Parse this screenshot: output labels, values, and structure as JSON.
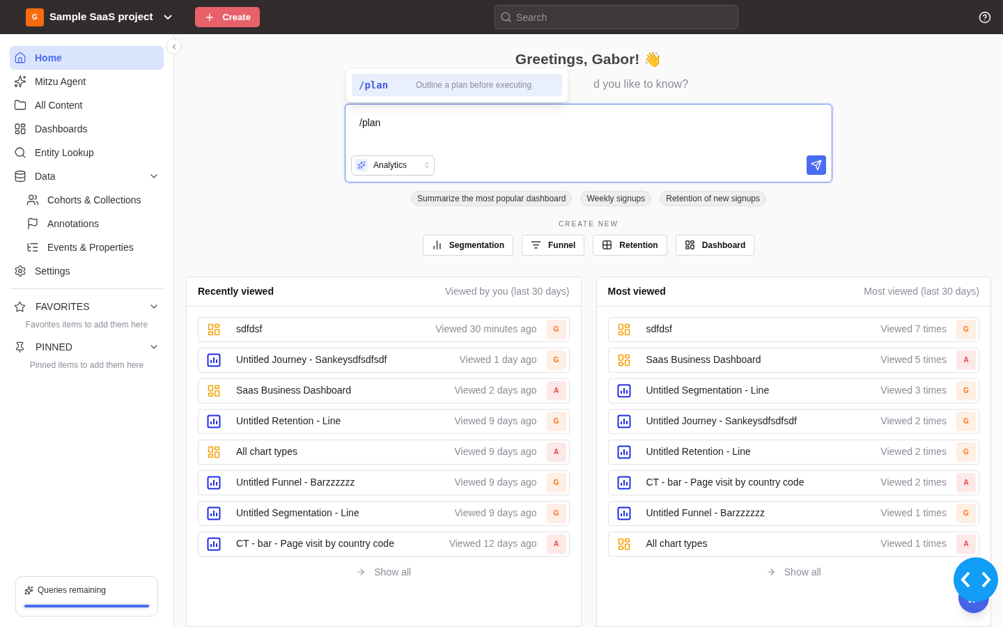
{
  "topbar": {
    "project_initial": "G",
    "project_name": "Sample SaaS project",
    "create_button": "Create",
    "search": {
      "placeholder": "Search"
    }
  },
  "sidebar": {
    "items": [
      {
        "label": "Home",
        "selected": true
      },
      {
        "label": "Mitzu Agent",
        "selected": false
      },
      {
        "label": "All Content",
        "selected": false
      },
      {
        "label": "Dashboards",
        "selected": false
      },
      {
        "label": "Entity Lookup",
        "selected": false
      },
      {
        "label": "Data",
        "selected": false,
        "expanded": true,
        "children": [
          {
            "label": "Cohorts & Collections",
            "selected": false
          },
          {
            "label": "Annotations",
            "selected": false
          },
          {
            "label": "Events & Properties",
            "selected": false
          }
        ]
      },
      {
        "label": "Settings",
        "selected": false
      }
    ],
    "sections": [
      {
        "label": "FAVORITES",
        "hint": "Favorites items to add them here"
      },
      {
        "label": "PINNED",
        "hint": "Pinned items to add them here"
      }
    ],
    "queries": {
      "label": "Queries remaining",
      "level": 1.0
    }
  },
  "main": {
    "greeting": "Greetings, Gabor! 👋",
    "subtitle": "d you like to know?",
    "command_menu": [
      {
        "command": "/plan",
        "description": "Outline a plan before executing",
        "selected": true
      }
    ],
    "prompt": {
      "value": "/plan",
      "mode": "Analytics"
    },
    "suggestions": [
      "Summarize the most popular dashboard",
      "Weekly signups",
      "Retention of new signups"
    ],
    "create_new": {
      "title": "CREATE NEW",
      "buttons": [
        {
          "label": "Segmentation",
          "kind": "segmentation"
        },
        {
          "label": "Funnel",
          "kind": "funnel"
        },
        {
          "label": "Retention",
          "kind": "retention"
        },
        {
          "label": "Dashboard",
          "kind": "dashboard"
        }
      ]
    },
    "panels": [
      {
        "title": "Recently viewed",
        "subtitle": "Viewed by you (last 30 days)",
        "show_all": "Show all",
        "items": [
          {
            "kind": "dashboard",
            "name": "sdfdsf",
            "meta": "Viewed 30 minutes ago",
            "avatar": "G",
            "color": "#f97316"
          },
          {
            "kind": "chart",
            "name": "Untitled Journey - Sankeysdfsdfsdf",
            "meta": "Viewed 1 day ago",
            "avatar": "G",
            "color": "#f97316"
          },
          {
            "kind": "dashboard",
            "name": "Saas Business Dashboard",
            "meta": "Viewed 2 days ago",
            "avatar": "A",
            "color": "#ef4444"
          },
          {
            "kind": "chart",
            "name": "Untitled Retention - Line",
            "meta": "Viewed 9 days ago",
            "avatar": "G",
            "color": "#f97316"
          },
          {
            "kind": "dashboard",
            "name": "All chart types",
            "meta": "Viewed 9 days ago",
            "avatar": "A",
            "color": "#ef4444"
          },
          {
            "kind": "chart",
            "name": "Untitled Funnel - Barzzzzzz",
            "meta": "Viewed 9 days ago",
            "avatar": "G",
            "color": "#f97316"
          },
          {
            "kind": "chart",
            "name": "Untitled Segmentation - Line",
            "meta": "Viewed 9 days ago",
            "avatar": "G",
            "color": "#f97316"
          },
          {
            "kind": "chart",
            "name": "CT - bar - Page visit by country code",
            "meta": "Viewed 12 days ago",
            "avatar": "A",
            "color": "#ef4444"
          }
        ]
      },
      {
        "title": "Most viewed",
        "subtitle": "Most viewed (last 30 days)",
        "show_all": "Show all",
        "items": [
          {
            "kind": "dashboard",
            "name": "sdfdsf",
            "meta": "Viewed 7 times",
            "avatar": "G",
            "color": "#f97316"
          },
          {
            "kind": "dashboard",
            "name": "Saas Business Dashboard",
            "meta": "Viewed 5 times",
            "avatar": "A",
            "color": "#ef4444"
          },
          {
            "kind": "chart",
            "name": "Untitled Segmentation - Line",
            "meta": "Viewed 3 times",
            "avatar": "G",
            "color": "#f97316"
          },
          {
            "kind": "chart",
            "name": "Untitled Journey - Sankeysdfsdfsdf",
            "meta": "Viewed 2 times",
            "avatar": "G",
            "color": "#f97316"
          },
          {
            "kind": "chart",
            "name": "Untitled Retention - Line",
            "meta": "Viewed 2 times",
            "avatar": "G",
            "color": "#f97316"
          },
          {
            "kind": "chart",
            "name": "CT - bar - Page visit by country code",
            "meta": "Viewed 2 times",
            "avatar": "A",
            "color": "#ef4444"
          },
          {
            "kind": "chart",
            "name": "Untitled Funnel - Barzzzzzz",
            "meta": "Viewed 1 times",
            "avatar": "G",
            "color": "#f97316"
          },
          {
            "kind": "dashboard",
            "name": "All chart types",
            "meta": "Viewed 1 times",
            "avatar": "A",
            "color": "#ef4444"
          }
        ]
      }
    ]
  }
}
